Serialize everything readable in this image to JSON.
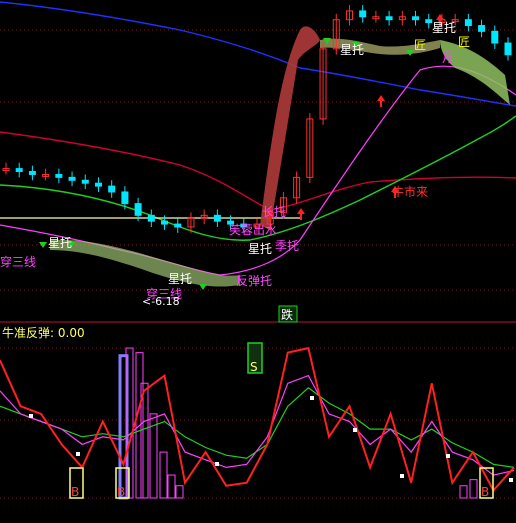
{
  "indicator": {
    "name": "牛准反弹",
    "value": "0.00"
  },
  "price_annotations": [
    "星托",
    "匠",
    "匠",
    "月",
    "星托",
    "牛市来",
    "芙蓉出水",
    "长托",
    "星托",
    "季托",
    "反弹托",
    "穿三线",
    "星托",
    "星托",
    "穿三线",
    "<-6.18"
  ],
  "markers": {
    "fall": "跌",
    "sell": "S",
    "buy": "B"
  },
  "colors": {
    "background": "#000000",
    "up_candle": "#ff3030",
    "down_candle": "#00e5ff",
    "ma_short": "#ff40ff",
    "ma_green": "#20d020",
    "ma_red": "#d00030",
    "ma_blue": "#2030ff",
    "support_line": "#ffffa0",
    "cloud_fill": "#c04040",
    "cloud_fill_alt": "#8fbf60",
    "indicator_main": "#ff2020",
    "indicator_fast": "#ff40ff",
    "indicator_slow": "#20d020",
    "indicator_bars": "#ff40ff"
  },
  "chart_data": [
    {
      "type": "candlestick",
      "title": "",
      "series": [
        {
          "name": "",
          "values": [
            0.45,
            0.44,
            0.43,
            0.43,
            0.42,
            0.41,
            0.4,
            0.39,
            0.37,
            0.33,
            0.29,
            0.27,
            0.26,
            0.25,
            0.28,
            0.29,
            0.27,
            0.26,
            0.25,
            0.26,
            0.3,
            0.35,
            0.42,
            0.62,
            0.86,
            0.96,
            0.99,
            0.97,
            0.97,
            0.96,
            0.97,
            0.96,
            0.95,
            0.96,
            0.96,
            0.94,
            0.92,
            0.88,
            0.84
          ]
        }
      ]
    },
    {
      "type": "line",
      "title": "牛准反弹",
      "x": [
        0,
        4,
        8,
        12,
        16,
        20,
        24,
        28,
        32,
        36,
        40,
        44,
        48,
        52,
        56,
        60,
        64,
        68,
        72,
        76,
        80,
        84,
        88,
        92,
        96,
        100
      ],
      "series": [
        {
          "name": "",
          "values": [
            0.9,
            0.6,
            0.55,
            0.35,
            0.2,
            0.5,
            0.22,
            0.7,
            0.8,
            0.1,
            0.3,
            0.08,
            0.1,
            0.35,
            0.95,
            0.98,
            0.4,
            0.6,
            0.2,
            0.55,
            0.1,
            0.75,
            0.1,
            0.3,
            0.05,
            0.2
          ]
        },
        {
          "name": "",
          "values": [
            0.7,
            0.55,
            0.5,
            0.45,
            0.35,
            0.4,
            0.38,
            0.5,
            0.55,
            0.3,
            0.25,
            0.2,
            0.22,
            0.4,
            0.75,
            0.8,
            0.55,
            0.5,
            0.35,
            0.45,
            0.3,
            0.5,
            0.3,
            0.25,
            0.15,
            0.18
          ]
        },
        {
          "name": "",
          "values": [
            0.6,
            0.55,
            0.5,
            0.45,
            0.4,
            0.42,
            0.4,
            0.45,
            0.5,
            0.4,
            0.33,
            0.28,
            0.26,
            0.35,
            0.6,
            0.72,
            0.62,
            0.55,
            0.45,
            0.45,
            0.38,
            0.45,
            0.36,
            0.3,
            0.22,
            0.2
          ]
        }
      ]
    }
  ]
}
